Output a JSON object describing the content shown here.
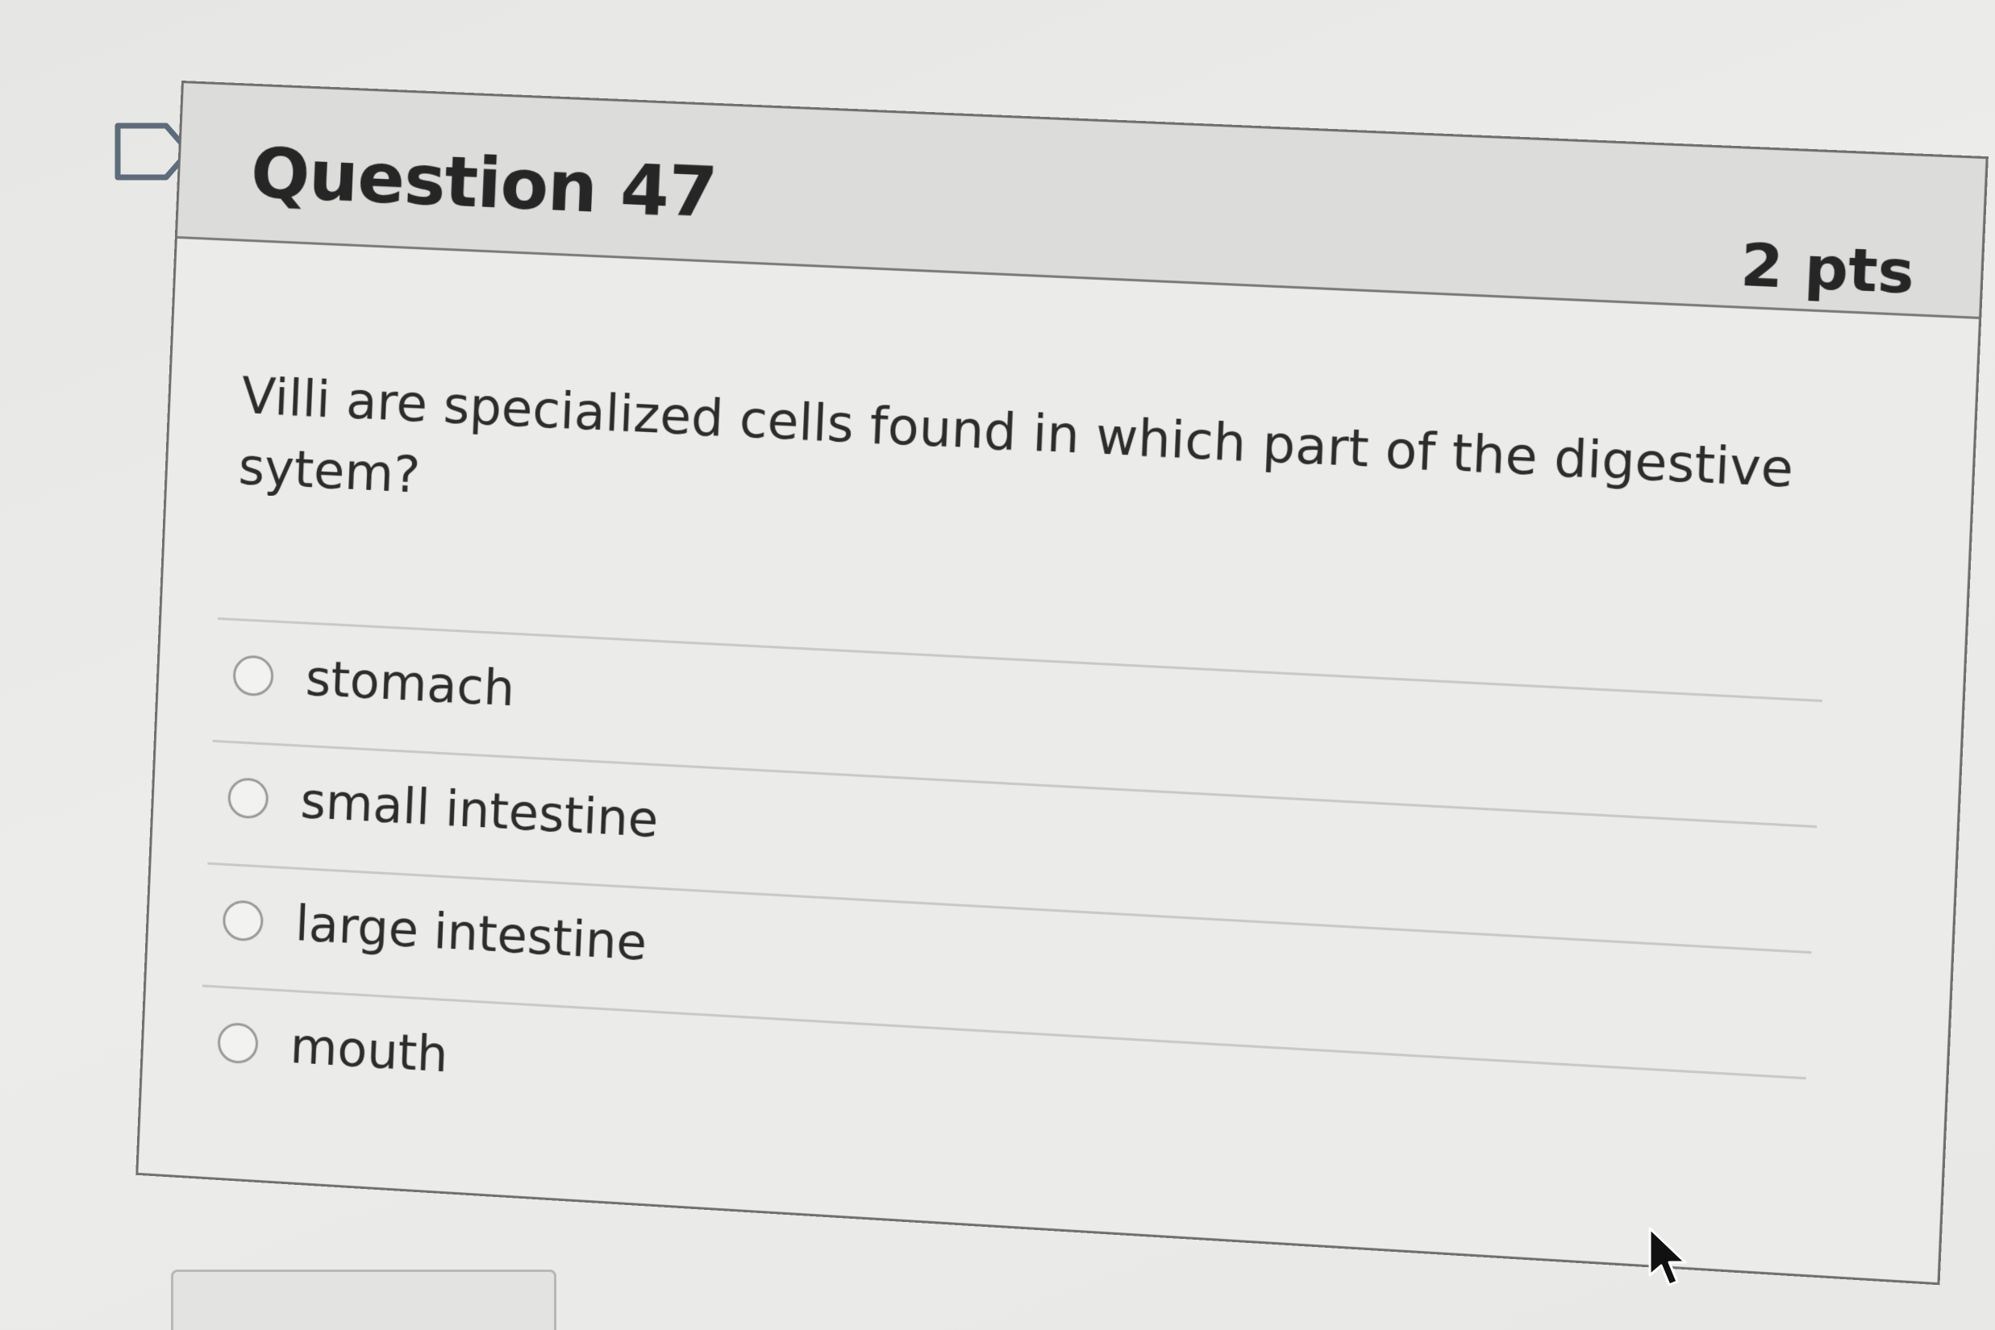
{
  "question": {
    "title": "Question 47",
    "points": "2 pts",
    "text": "Villi are specialized cells found in which part of the digestive sytem?",
    "answers": [
      {
        "label": "stomach"
      },
      {
        "label": "small intestine"
      },
      {
        "label": "large intestine"
      },
      {
        "label": "mouth"
      }
    ]
  },
  "icons": {
    "flag": "flag-question-icon",
    "cursor": "mouse-cursor-icon"
  }
}
